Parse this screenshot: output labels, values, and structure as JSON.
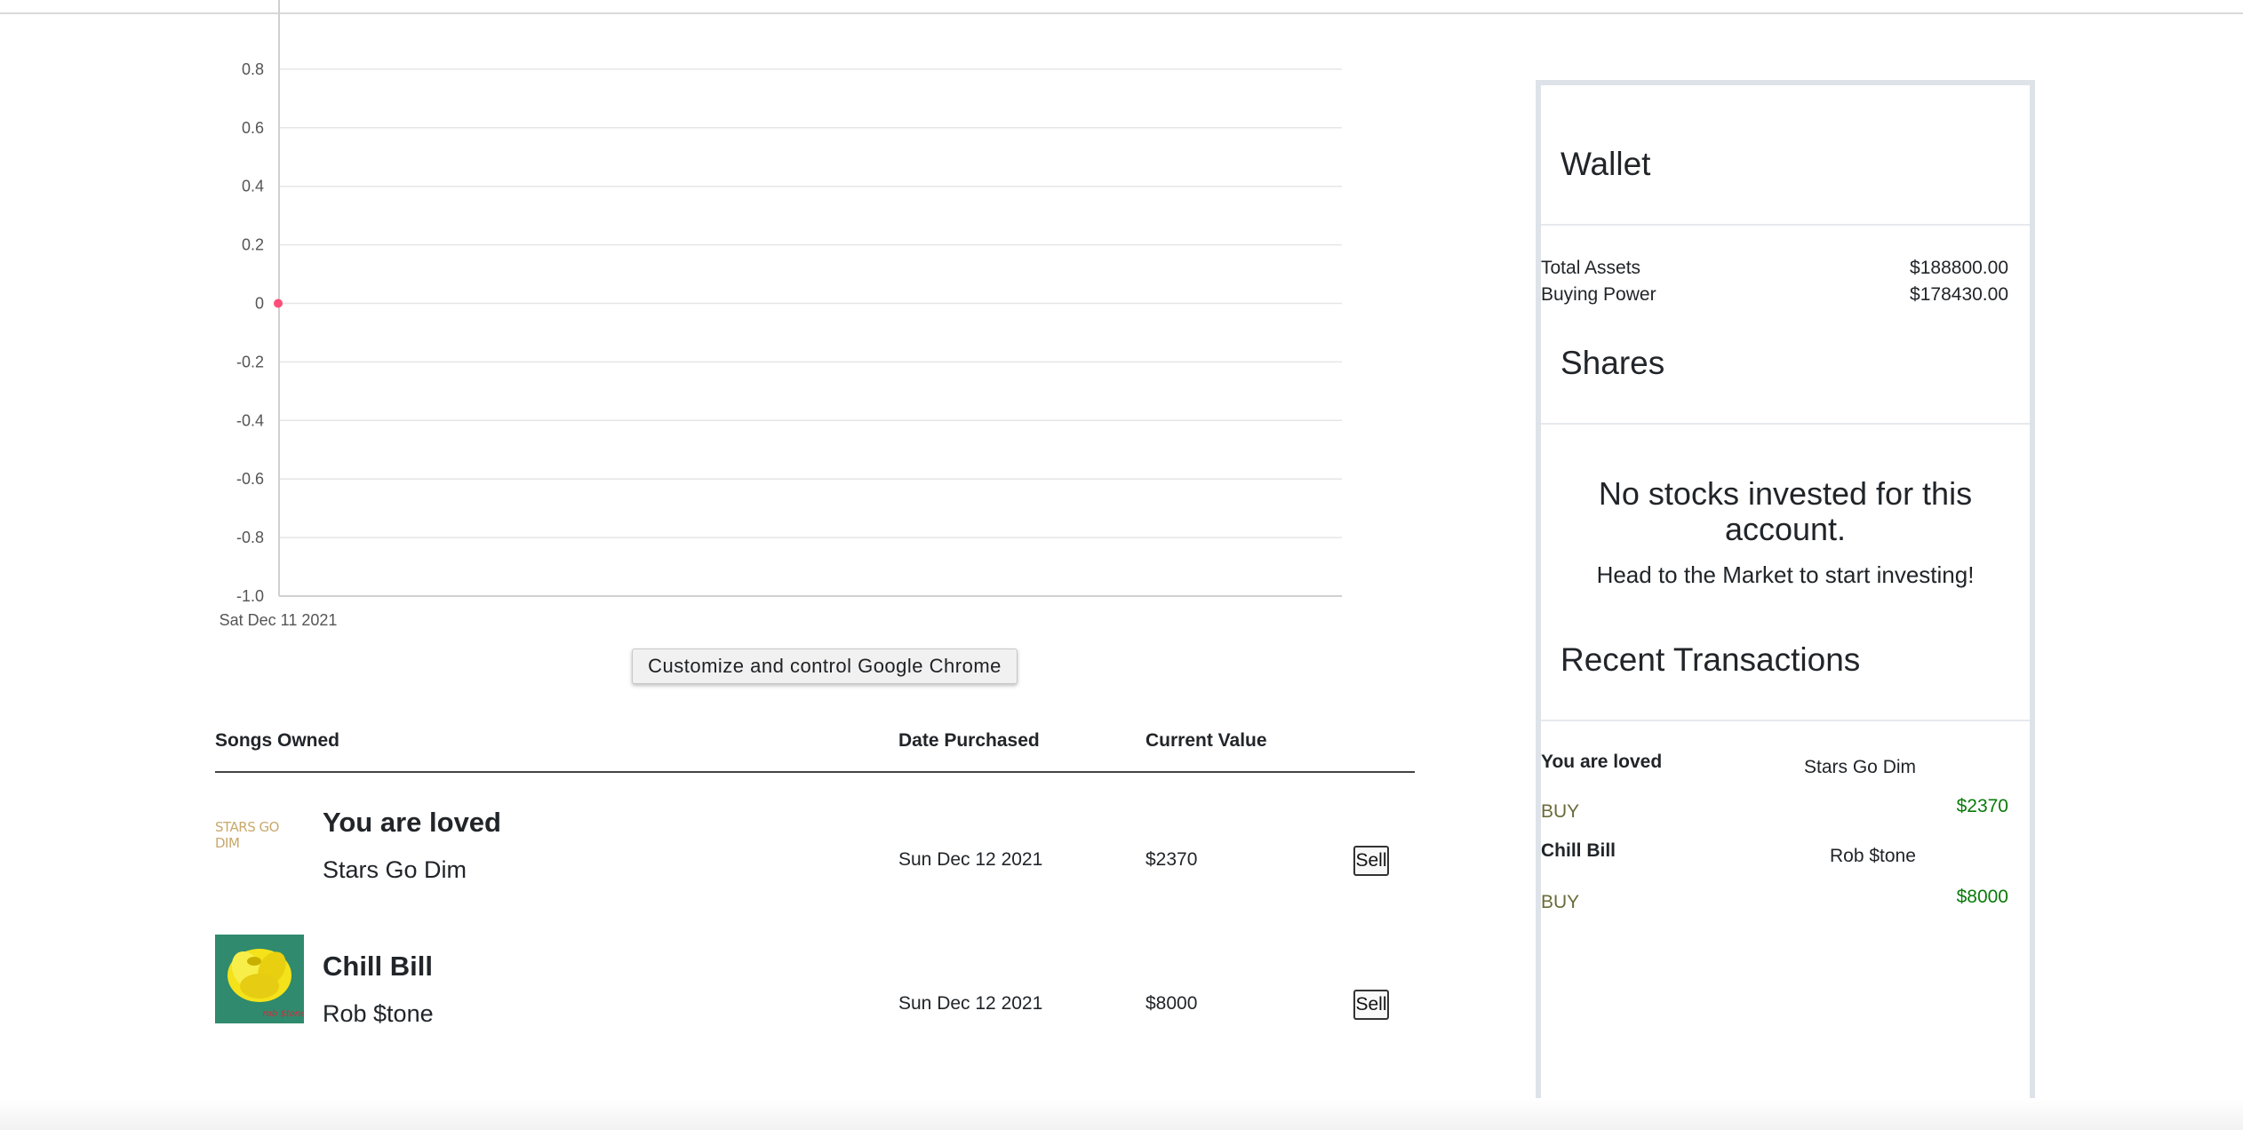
{
  "chart": {
    "y_ticks": [
      "0.8",
      "0.6",
      "0.4",
      "0.2",
      "0",
      "-0.2",
      "-0.4",
      "-0.6",
      "-0.8",
      "-1.0"
    ],
    "x_label": "Sat Dec 11 2021",
    "point_color": "#ff4d79"
  },
  "chart_data": {
    "type": "line",
    "x": [
      "Sat Dec 11 2021"
    ],
    "y": [
      0
    ],
    "ylim": [
      -1.0,
      1.0
    ],
    "grid": true
  },
  "tooltip": {
    "text": "Customize and control Google Chrome"
  },
  "songs_table": {
    "headers": {
      "song": "Songs Owned",
      "date": "Date Purchased",
      "value": "Current Value"
    },
    "rows": [
      {
        "title": "You are loved",
        "artist": "Stars Go Dim",
        "date": "Sun Dec 12 2021",
        "value": "$2370",
        "action": "Sell",
        "art_text": "STARS GO DIM"
      },
      {
        "title": "Chill Bill",
        "artist": "Rob $tone",
        "date": "Sun Dec 12 2021",
        "value": "$8000",
        "action": "Sell",
        "art_text": "rob $tone"
      }
    ]
  },
  "wallet": {
    "title": "Wallet",
    "total_assets_label": "Total Assets",
    "total_assets_value": "$188800.00",
    "buying_power_label": "Buying Power",
    "buying_power_value": "$178430.00"
  },
  "shares": {
    "title": "Shares",
    "empty_title": "No stocks invested for this account.",
    "empty_subtitle": "Head to the Market to start investing!"
  },
  "transactions": {
    "title": "Recent Transactions",
    "items": [
      {
        "song": "You are loved",
        "artist": "Stars Go Dim",
        "type": "BUY",
        "amount": "$2370"
      },
      {
        "song": "Chill Bill",
        "artist": "Rob $tone",
        "type": "BUY",
        "amount": "$8000"
      }
    ]
  },
  "colors": {
    "buy": "#6b6b3a",
    "amount": "#0a7a0a",
    "sidebar_border": "#dde3e8"
  }
}
